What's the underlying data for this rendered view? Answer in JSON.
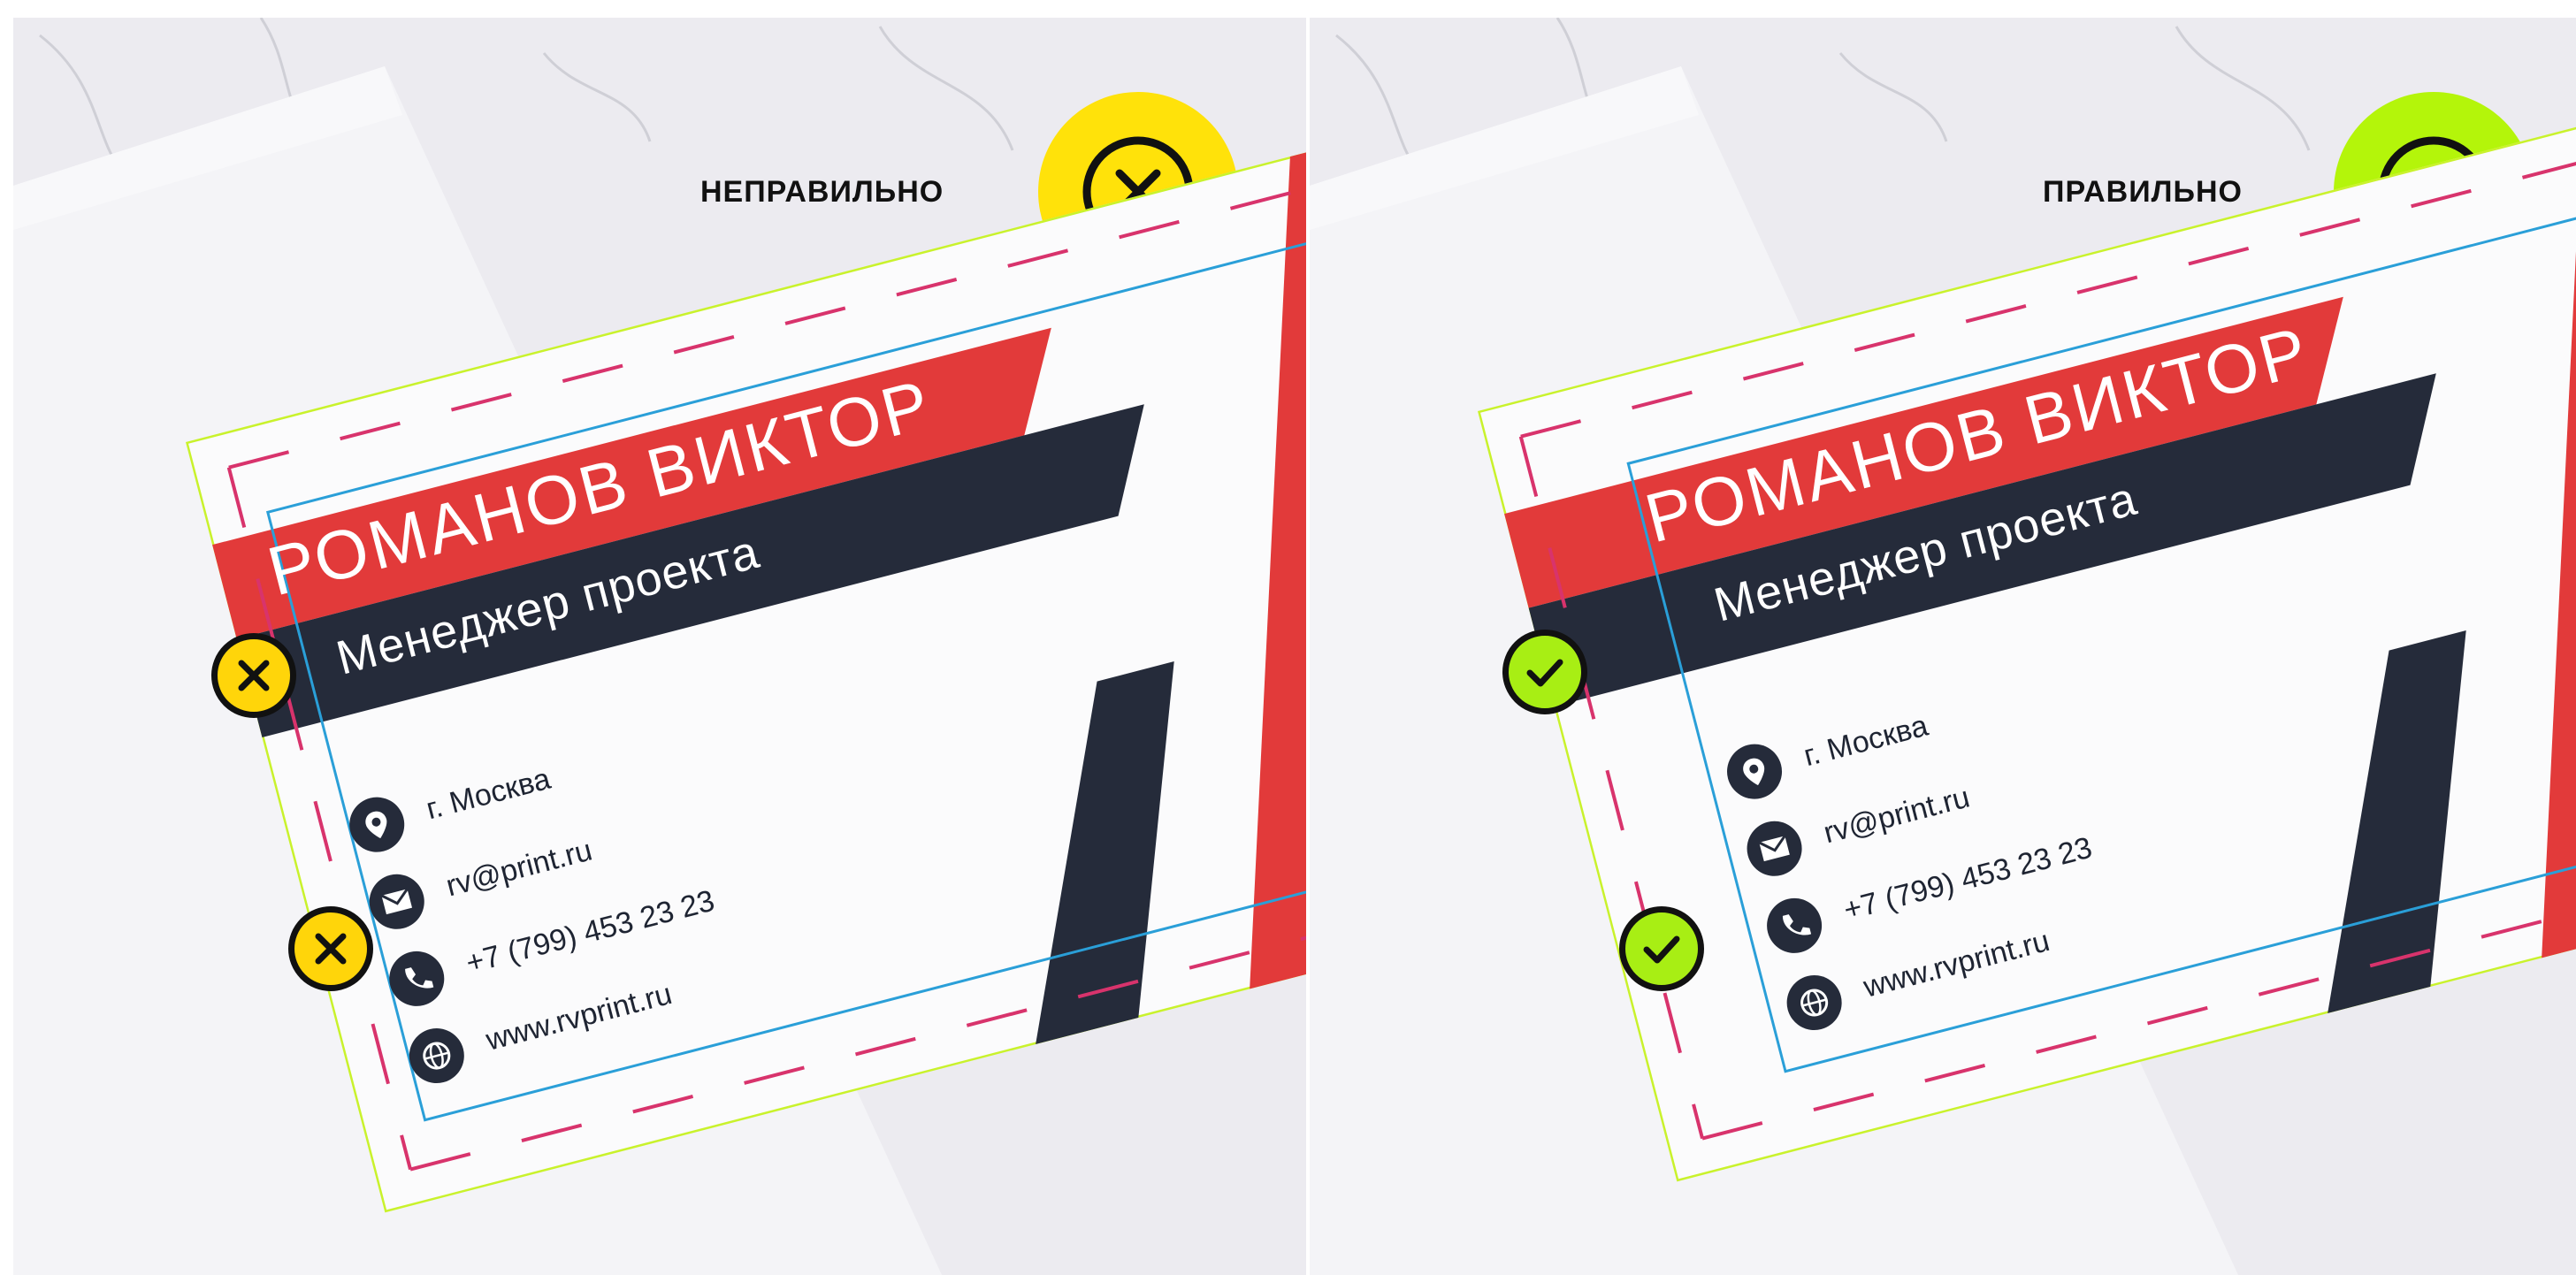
{
  "panels": [
    {
      "verdict": "НЕПРАВИЛЬНО",
      "status": "incorrect",
      "badge_icon": "close-icon",
      "badge_color": "#ffe20a"
    },
    {
      "verdict": "ПРАВИЛЬНО",
      "status": "correct",
      "badge_icon": "check-icon",
      "badge_color": "#b4f50a"
    }
  ],
  "card": {
    "name": "РОМАНОВ ВИКТОР",
    "position": "Менеджер проекта",
    "city": "г. Москва",
    "email": "rv@print.ru",
    "phone": "+7 (799) 453 23 23",
    "website": "www.rvprint.ru",
    "icons": [
      "location-icon",
      "mail-icon",
      "phone-icon",
      "globe-icon"
    ],
    "colors": {
      "red": "#e23a3a",
      "navy": "#252b3a",
      "trim_line": "#c9f22c",
      "safe_line": "#2a9fd8",
      "bleed_dash": "#d8336c"
    }
  }
}
